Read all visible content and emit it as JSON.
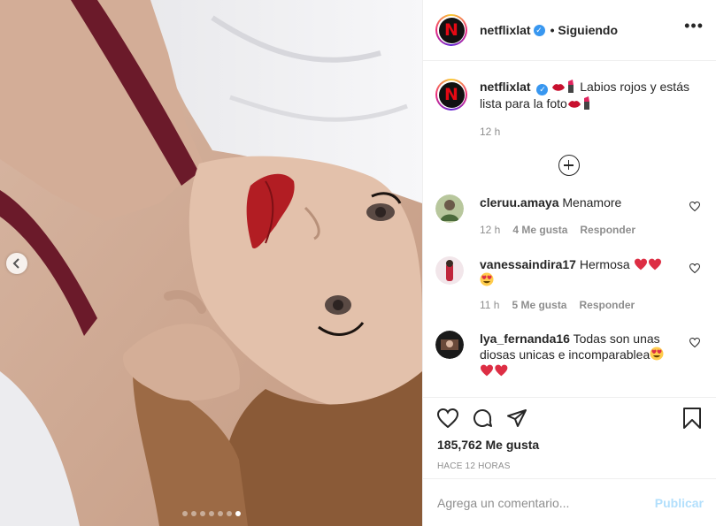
{
  "post": {
    "username": "netflixlat",
    "avatar_letter": "N",
    "follow_status": "• Siguiendo",
    "more_label": "•••",
    "caption_text_1": "Labios rojos y estás lista para la foto",
    "caption_time": "12 h",
    "likes": "185,762 Me gusta",
    "timestamp": "HACE 12 HORAS",
    "carousel_total": 7,
    "carousel_active": 7
  },
  "comments": [
    {
      "username": "cleruu.amaya",
      "text": "Menamore",
      "time": "12 h",
      "likes": "4 Me gusta",
      "reply": "Responder"
    },
    {
      "username": "vanessaindira17",
      "text": "Hermosa",
      "time": "11 h",
      "likes": "5 Me gusta",
      "reply": "Responder"
    },
    {
      "username": "lya_fernanda16",
      "text": "Todas son unas diosas unicas e incomparablea"
    }
  ],
  "add_comment": {
    "placeholder": "Agrega un comentario...",
    "publish": "Publicar"
  },
  "colors": {
    "verified": "#3897f0",
    "netflix_red": "#e50914",
    "publish": "#b2dffc",
    "heart_red": "#e0245e"
  },
  "icons": [
    "chevron-left-icon",
    "verified-icon",
    "more-icon",
    "plus-circle-icon",
    "heart-icon",
    "comment-icon",
    "share-icon",
    "bookmark-icon"
  ]
}
